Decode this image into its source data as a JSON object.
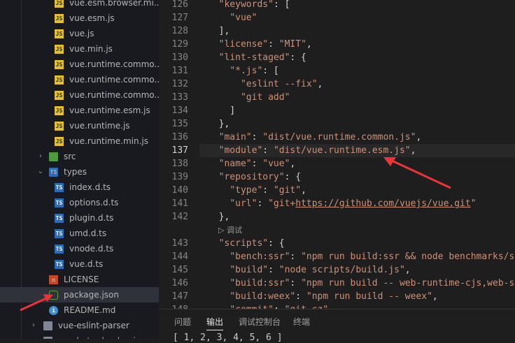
{
  "explorer": {
    "items": [
      {
        "label": "vue.esm.browser.mi...",
        "icon": "js-file-icon",
        "kind": "js",
        "depth": 2
      },
      {
        "label": "vue.esm.js",
        "icon": "js-file-icon",
        "kind": "js",
        "depth": 2
      },
      {
        "label": "vue.js",
        "icon": "js-file-icon",
        "kind": "js",
        "depth": 2
      },
      {
        "label": "vue.min.js",
        "icon": "js-file-icon",
        "kind": "js",
        "depth": 2
      },
      {
        "label": "vue.runtime.commo...",
        "icon": "js-file-icon",
        "kind": "js",
        "depth": 2
      },
      {
        "label": "vue.runtime.commo...",
        "icon": "js-file-icon",
        "kind": "js",
        "depth": 2
      },
      {
        "label": "vue.runtime.commo...",
        "icon": "js-file-icon",
        "kind": "js",
        "depth": 2
      },
      {
        "label": "vue.runtime.esm.js",
        "icon": "js-file-icon",
        "kind": "js",
        "depth": 2
      },
      {
        "label": "vue.runtime.js",
        "icon": "js-file-icon",
        "kind": "js",
        "depth": 2
      },
      {
        "label": "vue.runtime.min.js",
        "icon": "js-file-icon",
        "kind": "js",
        "depth": 2
      },
      {
        "label": "src",
        "icon": "folder-src-icon",
        "kind": "folder-src",
        "depth": 1,
        "chevron": "›"
      },
      {
        "label": "types",
        "icon": "folder-ts-icon",
        "kind": "folder-ts",
        "depth": 1,
        "chevron": "⌄"
      },
      {
        "label": "index.d.ts",
        "icon": "ts-file-icon",
        "kind": "ts",
        "depth": 2
      },
      {
        "label": "options.d.ts",
        "icon": "ts-file-icon",
        "kind": "ts",
        "depth": 2
      },
      {
        "label": "plugin.d.ts",
        "icon": "ts-file-icon",
        "kind": "ts",
        "depth": 2
      },
      {
        "label": "umd.d.ts",
        "icon": "ts-file-icon",
        "kind": "ts",
        "depth": 2
      },
      {
        "label": "vnode.d.ts",
        "icon": "ts-file-icon",
        "kind": "ts",
        "depth": 2
      },
      {
        "label": "vue.d.ts",
        "icon": "ts-file-icon",
        "kind": "ts",
        "depth": 2
      },
      {
        "label": "LICENSE",
        "icon": "license-icon",
        "kind": "license",
        "depth": 1
      },
      {
        "label": "package.json",
        "icon": "package-json-icon",
        "kind": "pkg",
        "depth": 1,
        "selected": true
      },
      {
        "label": "README.md",
        "icon": "info-icon",
        "kind": "info",
        "depth": 1
      },
      {
        "label": "vue-eslint-parser",
        "icon": "folder-icon",
        "kind": "folder",
        "depth": 0,
        "chevron": "›"
      },
      {
        "label": "vue-hot-reload-api",
        "icon": "folder-icon",
        "kind": "folder",
        "depth": 0,
        "chevron": "›"
      }
    ]
  },
  "editor": {
    "active_line": "137",
    "lines": [
      {
        "n": "126",
        "tokens": [
          [
            "pun",
            "  "
          ],
          [
            "str",
            "\"keywords\""
          ],
          [
            "pun",
            ": ["
          ]
        ]
      },
      {
        "n": "127",
        "tokens": [
          [
            "pun",
            "    "
          ],
          [
            "str",
            "\"vue\""
          ]
        ]
      },
      {
        "n": "128",
        "tokens": [
          [
            "pun",
            "  ],"
          ]
        ]
      },
      {
        "n": "129",
        "tokens": [
          [
            "pun",
            "  "
          ],
          [
            "str",
            "\"license\""
          ],
          [
            "pun",
            ": "
          ],
          [
            "str",
            "\"MIT\""
          ],
          [
            "pun",
            ","
          ]
        ]
      },
      {
        "n": "130",
        "tokens": [
          [
            "pun",
            "  "
          ],
          [
            "str",
            "\"lint-staged\""
          ],
          [
            "pun",
            ": {"
          ]
        ]
      },
      {
        "n": "131",
        "tokens": [
          [
            "pun",
            "    "
          ],
          [
            "str",
            "\"*.js\""
          ],
          [
            "pun",
            ": ["
          ]
        ]
      },
      {
        "n": "132",
        "tokens": [
          [
            "pun",
            "      "
          ],
          [
            "str",
            "\"eslint --fix\""
          ],
          [
            "pun",
            ","
          ]
        ]
      },
      {
        "n": "133",
        "tokens": [
          [
            "pun",
            "      "
          ],
          [
            "str",
            "\"git add\""
          ]
        ]
      },
      {
        "n": "134",
        "tokens": [
          [
            "pun",
            "    ]"
          ]
        ]
      },
      {
        "n": "135",
        "tokens": [
          [
            "pun",
            "  },"
          ]
        ]
      },
      {
        "n": "136",
        "tokens": [
          [
            "pun",
            "  "
          ],
          [
            "str",
            "\"main\""
          ],
          [
            "pun",
            ": "
          ],
          [
            "str",
            "\"dist/vue.runtime.common.js\""
          ],
          [
            "pun",
            ","
          ]
        ]
      },
      {
        "n": "137",
        "tokens": [
          [
            "pun",
            "  "
          ],
          [
            "str",
            "\"module\""
          ],
          [
            "pun",
            ": "
          ],
          [
            "str",
            "\"dist/vue.runtime.esm.js\""
          ],
          [
            "pun",
            ","
          ]
        ]
      },
      {
        "n": "138",
        "tokens": [
          [
            "pun",
            "  "
          ],
          [
            "str",
            "\"name\""
          ],
          [
            "pun",
            ": "
          ],
          [
            "str",
            "\"vue\""
          ],
          [
            "pun",
            ","
          ]
        ]
      },
      {
        "n": "139",
        "tokens": [
          [
            "pun",
            "  "
          ],
          [
            "str",
            "\"repository\""
          ],
          [
            "pun",
            ": {"
          ]
        ]
      },
      {
        "n": "140",
        "tokens": [
          [
            "pun",
            "    "
          ],
          [
            "str",
            "\"type\""
          ],
          [
            "pun",
            ": "
          ],
          [
            "str",
            "\"git\""
          ],
          [
            "pun",
            ","
          ]
        ]
      },
      {
        "n": "141",
        "tokens": [
          [
            "pun",
            "    "
          ],
          [
            "str",
            "\"url\""
          ],
          [
            "pun",
            ": "
          ],
          [
            "str",
            "\"git+"
          ],
          [
            "url",
            "https://github.com/vuejs/vue.git"
          ],
          [
            "str",
            "\""
          ]
        ]
      },
      {
        "n": "142",
        "tokens": [
          [
            "pun",
            "  },"
          ]
        ]
      },
      {
        "lens": "▷ 调试"
      },
      {
        "n": "143",
        "tokens": [
          [
            "pun",
            "  "
          ],
          [
            "str",
            "\"scripts\""
          ],
          [
            "pun",
            ": {"
          ]
        ]
      },
      {
        "n": "144",
        "tokens": [
          [
            "pun",
            "    "
          ],
          [
            "str",
            "\"bench:ssr\""
          ],
          [
            "pun",
            ": "
          ],
          [
            "str",
            "\"npm run build:ssr && node benchmarks/ssr"
          ]
        ]
      },
      {
        "n": "145",
        "tokens": [
          [
            "pun",
            "    "
          ],
          [
            "str",
            "\"build\""
          ],
          [
            "pun",
            ": "
          ],
          [
            "str",
            "\"node scripts/build.js\""
          ],
          [
            "pun",
            ","
          ]
        ]
      },
      {
        "n": "146",
        "tokens": [
          [
            "pun",
            "    "
          ],
          [
            "str",
            "\"build:ssr\""
          ],
          [
            "pun",
            ": "
          ],
          [
            "str",
            "\"npm run build -- web-runtime-cjs,web-ser"
          ]
        ]
      },
      {
        "n": "147",
        "tokens": [
          [
            "pun",
            "    "
          ],
          [
            "str",
            "\"build:weex\""
          ],
          [
            "pun",
            ": "
          ],
          [
            "str",
            "\"npm run build -- weex\""
          ],
          [
            "pun",
            ","
          ]
        ]
      },
      {
        "n": "148",
        "tokens": [
          [
            "pun",
            "    "
          ],
          [
            "str",
            "\"commit\""
          ],
          [
            "pun",
            ": "
          ],
          [
            "str",
            "\"git-cz\""
          ],
          [
            "pun",
            ","
          ]
        ]
      }
    ]
  },
  "panel": {
    "tabs": [
      {
        "label": "问题",
        "active": false
      },
      {
        "label": "输出",
        "active": true
      },
      {
        "label": "调试控制台",
        "active": false
      },
      {
        "label": "终端",
        "active": false
      }
    ],
    "output": "[ 1, 2, 3, 4, 5, 6 ]"
  },
  "colors": {
    "annotation_arrow": "#e8343a",
    "string": "#ce9178",
    "line_number": "#858585"
  }
}
